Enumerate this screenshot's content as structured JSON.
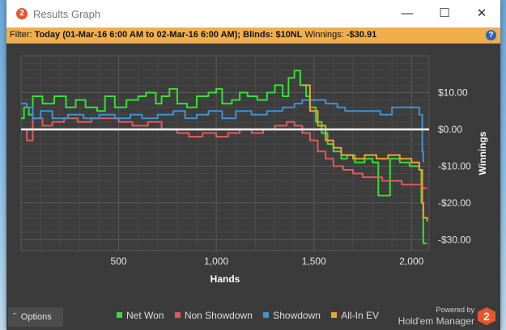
{
  "window": {
    "title": "Results Graph",
    "app_icon": "2"
  },
  "filter": {
    "prefix": "Filter: ",
    "date": "Today (01-Mar-16 6:00 AM to 02-Mar-16 6:00 AM);",
    "blinds": "Blinds: $10NL",
    "winnings_label": "Winnings:",
    "winnings_value": "-$30.91"
  },
  "bottom": {
    "options_label": "Options",
    "powered_by": "Powered by",
    "product": "Hold'em Manager",
    "logo": "2"
  },
  "colors": {
    "net_won": "#33e233",
    "non_showdown": "#e05a5a",
    "showdown": "#3f92d6",
    "all_in_ev": "#f0a030",
    "filter_bar": "#f1ae4c",
    "background": "#3b3b3b"
  },
  "chart_data": {
    "type": "line",
    "xlabel": "Hands",
    "ylabel": "Winnings",
    "xlim": [
      0,
      2090
    ],
    "ylim": [
      -33,
      20
    ],
    "x_ticks": [
      500,
      1000,
      1500,
      2000
    ],
    "x_tick_labels": [
      "500",
      "1,000",
      "1,500",
      "2,000"
    ],
    "y_ticks": [
      10,
      0,
      -10,
      -20,
      -30
    ],
    "y_tick_labels": [
      "$10.00",
      "$0.00",
      "-$10.00",
      "-$20.00",
      "-$30.00"
    ],
    "grid": true,
    "zero_line": true,
    "legend_position": "bottom",
    "series": [
      {
        "name": "Net Won",
        "color": "#33e233",
        "points": [
          [
            0,
            3
          ],
          [
            15,
            6
          ],
          [
            40,
            4
          ],
          [
            60,
            9
          ],
          [
            110,
            7
          ],
          [
            170,
            9
          ],
          [
            230,
            6
          ],
          [
            280,
            8
          ],
          [
            330,
            6
          ],
          [
            390,
            5
          ],
          [
            430,
            9
          ],
          [
            480,
            6
          ],
          [
            540,
            8
          ],
          [
            600,
            9
          ],
          [
            640,
            10
          ],
          [
            690,
            7
          ],
          [
            720,
            9
          ],
          [
            760,
            11
          ],
          [
            800,
            7
          ],
          [
            850,
            6
          ],
          [
            900,
            9
          ],
          [
            960,
            10
          ],
          [
            1000,
            11
          ],
          [
            1030,
            7
          ],
          [
            1080,
            8
          ],
          [
            1120,
            10
          ],
          [
            1160,
            9
          ],
          [
            1210,
            8
          ],
          [
            1260,
            10
          ],
          [
            1300,
            12
          ],
          [
            1340,
            9
          ],
          [
            1370,
            14
          ],
          [
            1400,
            16
          ],
          [
            1430,
            12
          ],
          [
            1460,
            9
          ],
          [
            1480,
            6
          ],
          [
            1510,
            2
          ],
          [
            1540,
            -1
          ],
          [
            1570,
            -4
          ],
          [
            1600,
            -6
          ],
          [
            1640,
            -8
          ],
          [
            1670,
            -7
          ],
          [
            1710,
            -9
          ],
          [
            1760,
            -8
          ],
          [
            1800,
            -9
          ],
          [
            1830,
            -18
          ],
          [
            1860,
            -18
          ],
          [
            1890,
            -8
          ],
          [
            1940,
            -9
          ],
          [
            1990,
            -10
          ],
          [
            2040,
            -11
          ],
          [
            2050,
            -20
          ],
          [
            2060,
            -31
          ],
          [
            2080,
            -31
          ]
        ]
      },
      {
        "name": "Non Showdown",
        "color": "#e05a5a",
        "points": [
          [
            0,
            0
          ],
          [
            30,
            -3
          ],
          [
            60,
            3
          ],
          [
            110,
            1
          ],
          [
            160,
            2
          ],
          [
            220,
            3
          ],
          [
            290,
            2
          ],
          [
            360,
            3
          ],
          [
            430,
            3
          ],
          [
            500,
            2
          ],
          [
            570,
            1
          ],
          [
            650,
            2
          ],
          [
            720,
            0
          ],
          [
            800,
            -1
          ],
          [
            860,
            -2
          ],
          [
            930,
            -1
          ],
          [
            1000,
            -2
          ],
          [
            1060,
            -1
          ],
          [
            1120,
            0
          ],
          [
            1180,
            -1
          ],
          [
            1240,
            0
          ],
          [
            1300,
            1
          ],
          [
            1360,
            2
          ],
          [
            1400,
            1
          ],
          [
            1440,
            -1
          ],
          [
            1480,
            -3
          ],
          [
            1520,
            -6
          ],
          [
            1560,
            -8
          ],
          [
            1600,
            -10
          ],
          [
            1650,
            -11
          ],
          [
            1700,
            -12
          ],
          [
            1750,
            -13
          ],
          [
            1800,
            -13
          ],
          [
            1850,
            -14
          ],
          [
            1900,
            -14
          ],
          [
            1950,
            -15
          ],
          [
            2000,
            -15
          ],
          [
            2050,
            -16
          ],
          [
            2080,
            -16
          ]
        ]
      },
      {
        "name": "Showdown",
        "color": "#3f92d6",
        "points": [
          [
            0,
            7
          ],
          [
            30,
            6
          ],
          [
            60,
            3
          ],
          [
            100,
            5
          ],
          [
            160,
            3
          ],
          [
            240,
            4
          ],
          [
            320,
            3
          ],
          [
            400,
            4
          ],
          [
            480,
            3
          ],
          [
            560,
            4
          ],
          [
            620,
            3
          ],
          [
            700,
            4
          ],
          [
            780,
            5
          ],
          [
            840,
            3
          ],
          [
            900,
            4
          ],
          [
            960,
            5
          ],
          [
            1030,
            3
          ],
          [
            1100,
            5
          ],
          [
            1180,
            4
          ],
          [
            1260,
            5
          ],
          [
            1340,
            6
          ],
          [
            1400,
            7
          ],
          [
            1440,
            8
          ],
          [
            1500,
            8
          ],
          [
            1560,
            7
          ],
          [
            1620,
            6
          ],
          [
            1660,
            5
          ],
          [
            1700,
            5
          ],
          [
            1760,
            5
          ],
          [
            1800,
            5
          ],
          [
            1840,
            4
          ],
          [
            1880,
            4
          ],
          [
            1900,
            6
          ],
          [
            1940,
            6
          ],
          [
            1980,
            6
          ],
          [
            2030,
            6
          ],
          [
            2040,
            4
          ],
          [
            2055,
            -6
          ],
          [
            2060,
            -9
          ]
        ]
      },
      {
        "name": "All-In EV",
        "color": "#f0a030",
        "points": [
          [
            1440,
            12
          ],
          [
            1480,
            5
          ],
          [
            1520,
            1
          ],
          [
            1560,
            -3
          ],
          [
            1600,
            -5
          ],
          [
            1640,
            -7
          ],
          [
            1700,
            -8
          ],
          [
            1760,
            -7
          ],
          [
            1820,
            -8
          ],
          [
            1880,
            -7
          ],
          [
            1940,
            -8
          ],
          [
            2000,
            -9
          ],
          [
            2040,
            -11
          ],
          [
            2055,
            -20
          ],
          [
            2060,
            -24
          ],
          [
            2080,
            -25
          ]
        ]
      }
    ]
  }
}
